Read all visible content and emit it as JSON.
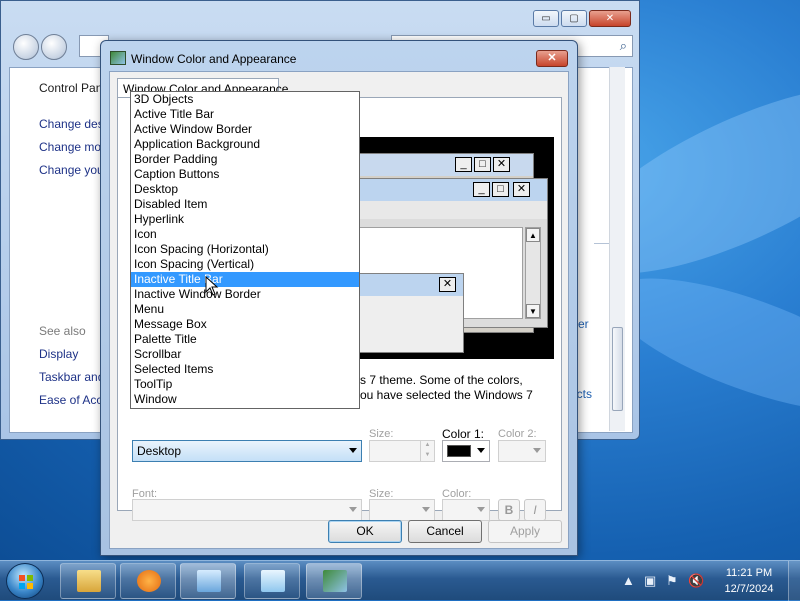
{
  "background_window": {
    "left_pane": {
      "home_link": "Control Pan",
      "tasks": [
        "Change des",
        "Change mo",
        "Change you"
      ],
      "see_also_label": "See also",
      "see_also_links": [
        "Display",
        "Taskbar and",
        "Ease of Acce"
      ]
    },
    "right_fragments": [
      "ver",
      "ects"
    ],
    "minimize_glyph": "▭",
    "maximize_glyph": "▢",
    "close_glyph": "✕"
  },
  "dialog": {
    "title": "Window Color and Appearance",
    "close_glyph": "✕",
    "tab_label": "Window Color and Appearance",
    "description": {
      "line1": "s 7 theme.  Some of the colors,",
      "line2": "ou have selected the Windows 7"
    },
    "item_selected_value": "Desktop",
    "labels": {
      "size": "Size:",
      "color1": "Color 1:",
      "color2": "Color 2:",
      "font": "Font:",
      "font_size": "Size:",
      "font_color": "Color:"
    },
    "bold_label": "B",
    "italic_label": "I",
    "buttons": {
      "ok": "OK",
      "cancel": "Cancel",
      "apply": "Apply"
    },
    "color1_value": "#000000"
  },
  "dropdown": {
    "items": [
      "3D Objects",
      "Active Title Bar",
      "Active Window Border",
      "Application Background",
      "Border Padding",
      "Caption Buttons",
      "Desktop",
      "Disabled Item",
      "Hyperlink",
      "Icon",
      "Icon Spacing (Horizontal)",
      "Icon Spacing (Vertical)",
      "Inactive Title Bar",
      "Inactive Window Border",
      "Menu",
      "Message Box",
      "Palette Title",
      "Scrollbar",
      "Selected Items",
      "ToolTip",
      "Window"
    ],
    "highlighted": "Inactive Title Bar"
  },
  "taskbar": {
    "time": "11:21 PM",
    "date": "12/7/2024"
  },
  "colors": {
    "selection": "#3399ff",
    "accent": "#3c7fb1"
  }
}
